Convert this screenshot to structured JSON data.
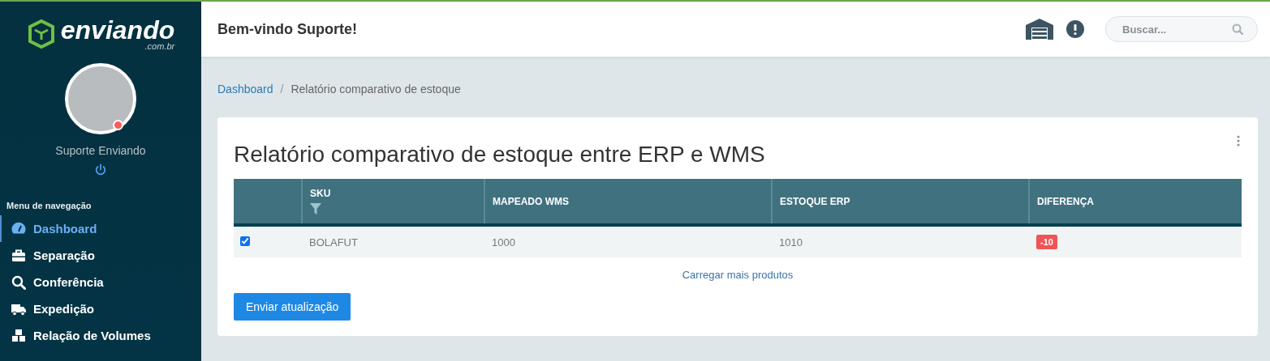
{
  "logo": {
    "name": "enviando",
    "domain": ".com.br"
  },
  "user": {
    "name": "Suporte Enviando",
    "online": false
  },
  "nav": {
    "title": "Menu de navegação",
    "items": [
      {
        "label": "Dashboard",
        "selected": true
      },
      {
        "label": "Separação",
        "selected": false
      },
      {
        "label": "Conferência",
        "selected": false
      },
      {
        "label": "Expedição",
        "selected": false
      },
      {
        "label": "Relação de Volumes",
        "selected": false
      }
    ]
  },
  "header": {
    "greeting": "Bem-vindo Suporte!",
    "search": {
      "placeholder": "Buscar..."
    }
  },
  "breadcrumb": {
    "separator": "/",
    "items": [
      {
        "label": "Dashboard",
        "link": true
      },
      {
        "label": "Relatório comparativo de estoque",
        "link": false
      }
    ]
  },
  "card": {
    "title": "Relatório comparativo de estoque entre ERP e WMS",
    "table": {
      "columns": [
        {
          "label": "SKU",
          "filter": true
        },
        {
          "label": "MAPEADO WMS",
          "filter": false
        },
        {
          "label": "ESTOQUE ERP",
          "filter": false
        },
        {
          "label": "DIFERENÇA",
          "filter": false
        }
      ],
      "rows": [
        {
          "selected": true,
          "cells": [
            "BOLAFUT",
            "1000",
            "1010"
          ],
          "difference": "-10"
        }
      ]
    },
    "load_more": "Carregar mais produtos",
    "submit": "Enviar atualização"
  }
}
